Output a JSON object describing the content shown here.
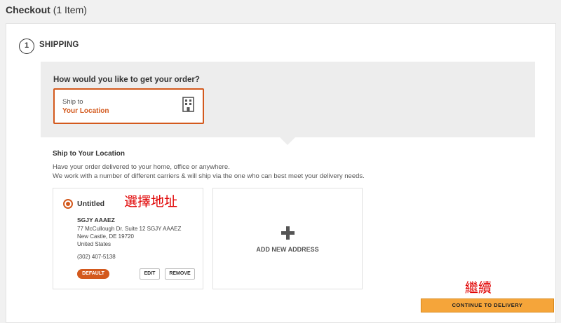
{
  "header": {
    "title": "Checkout",
    "count": "(1 Item)"
  },
  "step": {
    "number": "1",
    "title": "SHIPPING"
  },
  "delivery_choice": {
    "question": "How would you like to get your order?",
    "option_small": "Ship to",
    "option_big": "Your Location",
    "option_icon": "building-icon"
  },
  "section": {
    "title": "Ship to Your Location",
    "desc_line1": "Have your order delivered to your home, office or anywhere.",
    "desc_line2": "We work with a number of different carriers & will ship via the one who can best meet your delivery needs."
  },
  "address": {
    "name": "Untitled",
    "person": "SGJY AAAEZ",
    "line1": "77 McCullough Dr. Suite 12 SGJY AAAEZ",
    "line2": "New Castle, DE 19720",
    "line3": "United States",
    "phone": "(302) 407-5138",
    "default_label": "DEFAULT",
    "edit_label": "EDIT",
    "remove_label": "REMOVE"
  },
  "new_address": {
    "label": "ADD NEW ADDRESS"
  },
  "annotations": {
    "select_address": "選擇地址",
    "continue": "繼續"
  },
  "continue_button": {
    "label": "CONTINUE TO DELIVERY"
  },
  "colors": {
    "accent": "#d3591d",
    "button": "#f5a53a",
    "panel_bg": "#ededed",
    "annotation": "#e00000"
  }
}
